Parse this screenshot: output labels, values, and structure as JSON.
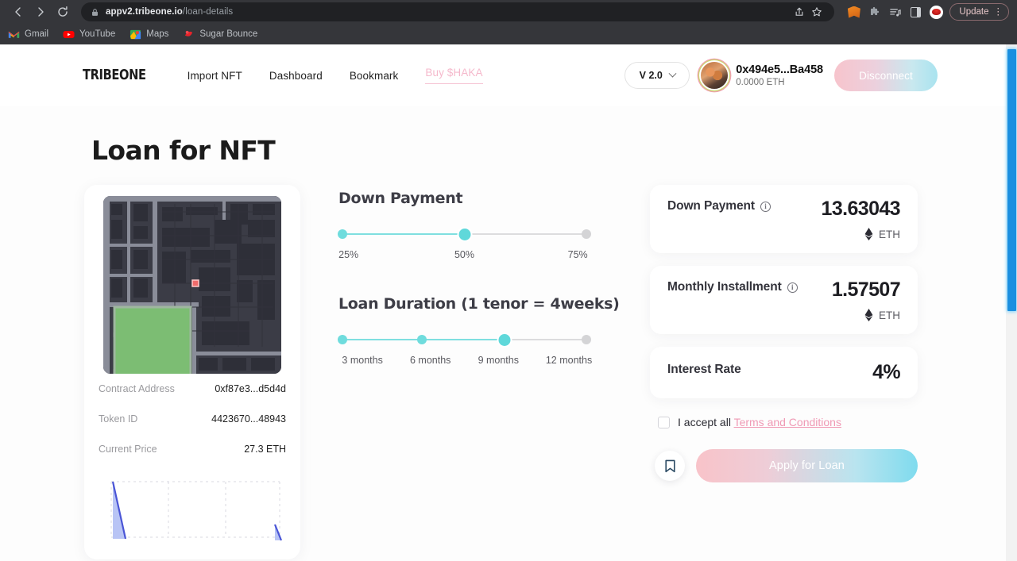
{
  "browser": {
    "url_bold": "appv2.tribeone.io",
    "url_rest": "/loan-details",
    "back_title": "Back",
    "forward_title": "Forward",
    "reload_title": "Reload",
    "share_title": "Share",
    "bookmark_title": "Bookmark this tab",
    "update_label": "Update",
    "menu_label": "⋮",
    "extensions": [
      {
        "name": "metamask-extension-icon"
      },
      {
        "name": "extensions-puzzle-icon"
      },
      {
        "name": "reading-list-icon"
      },
      {
        "name": "side-panel-icon"
      },
      {
        "name": "lips-extension-icon"
      }
    ],
    "bookmarks": [
      {
        "label": "Gmail",
        "icon": "gmail-icon"
      },
      {
        "label": "YouTube",
        "icon": "youtube-icon"
      },
      {
        "label": "Maps",
        "icon": "google-maps-icon"
      },
      {
        "label": "Sugar Bounce",
        "icon": "sugar-bounce-icon"
      }
    ]
  },
  "header": {
    "logo": "TRIBEONE",
    "nav": [
      {
        "label": "Import NFT"
      },
      {
        "label": "Dashboard"
      },
      {
        "label": "Bookmark"
      },
      {
        "label": "Buy $HAKA"
      }
    ],
    "version": "V 2.0",
    "wallet_address": "0x494e5...Ba458",
    "wallet_balance": "0.0000 ETH",
    "disconnect_label": "Disconnect"
  },
  "page_title": "Loan for NFT",
  "nft": {
    "rows": [
      {
        "key": "Contract Address",
        "value": "0xf87e3...d5d4d"
      },
      {
        "key": "Token ID",
        "value": "4423670...48943"
      },
      {
        "key": "Current Price",
        "value": "27.3 ETH"
      }
    ]
  },
  "down_payment": {
    "title": "Down Payment",
    "ticks": [
      "25%",
      "50%",
      "75%"
    ],
    "selected_index": 1
  },
  "loan_duration": {
    "title": "Loan Duration (1 tenor = 4weeks)",
    "ticks": [
      "3 months",
      "6 months",
      "9 months",
      "12 months"
    ],
    "selected_index": 2
  },
  "summary": {
    "down_payment": {
      "label": "Down Payment",
      "value": "13.63043",
      "unit": "ETH"
    },
    "monthly_installment": {
      "label": "Monthly Installment",
      "value": "1.57507",
      "unit": "ETH"
    },
    "interest_rate": {
      "label": "Interest Rate",
      "value": "4%"
    },
    "terms_prefix": "I accept all ",
    "terms_link": "Terms and Conditions",
    "apply_label": "Apply for Loan"
  },
  "colors": {
    "accent_cyan": "#6fdcdd",
    "accent_pink": "#f5b9cc",
    "scrollbar": "#1a8fe0"
  }
}
